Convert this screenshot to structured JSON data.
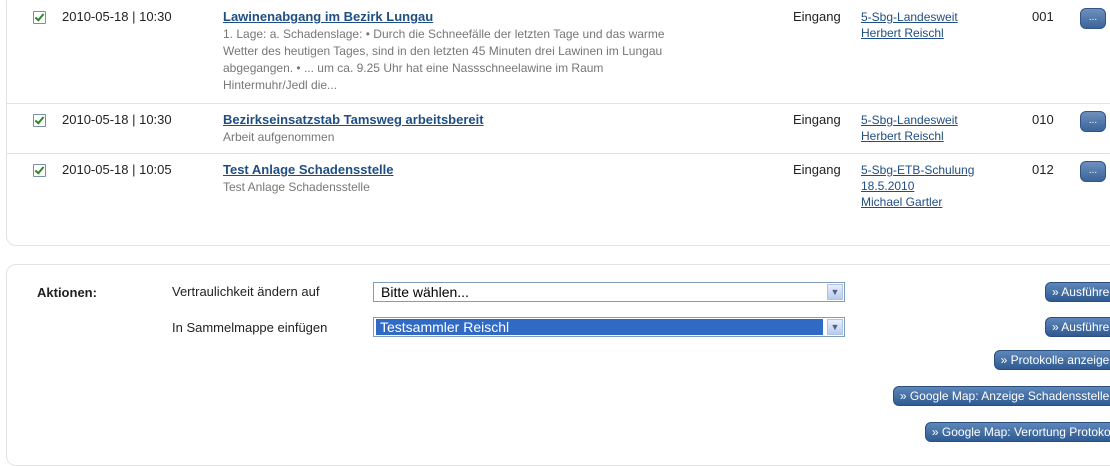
{
  "entries": [
    {
      "date": "2010-05-18 | 10:30",
      "title": "Lawinenabgang im Bezirk Lungau",
      "description": "1. Lage: a. Schadenslage: • Durch die Schneefälle der letzten Tage und das warme Wetter des heutigen Tages, sind in den letzten 45 Minuten drei Lawinen im Lungau abgegangen. • ... um ca. 9.25 Uhr hat eine Nassschneelawine im Raum Hintermuhr/Jedl die...",
      "type": "Eingang",
      "source_lines": [
        "5-Sbg-Landesweit",
        "Herbert Reischl"
      ],
      "number": "001",
      "more_label": "..."
    },
    {
      "date": "2010-05-18 | 10:30",
      "title": "Bezirkseinsatzstab Tamsweg arbeitsbereit",
      "description": "Arbeit aufgenommen",
      "type": "Eingang",
      "source_lines": [
        "5-Sbg-Landesweit",
        "Herbert Reischl"
      ],
      "number": "010",
      "more_label": "..."
    },
    {
      "date": "2010-05-18 | 10:05",
      "title": "Test Anlage Schadensstelle",
      "description": "Test Anlage Schadensstelle",
      "type": "Eingang",
      "source_lines": [
        "5-Sbg-ETB-Schulung",
        "18.5.2010",
        "Michael Gartler"
      ],
      "number": "012",
      "more_label": "..."
    }
  ],
  "actions": {
    "label": "Aktionen:",
    "confidentiality_label": "Vertraulichkeit ändern auf",
    "confidentiality_value": "Bitte wählen...",
    "folder_label": "In Sammelmappe einfügen",
    "folder_value": "Testsammler Reischl",
    "execute_label_1": "» Ausführen",
    "execute_label_2": "» Ausführen",
    "show_protocols_label": "» Protokolle anzeigen",
    "map_damage_label": "» Google Map: Anzeige Schadensstellen",
    "map_protocol_label": "» Google Map: Verortung Protokoll"
  }
}
